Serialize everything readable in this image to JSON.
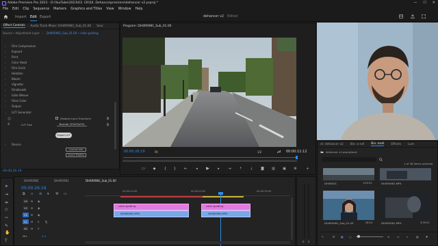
{
  "titlebar": {
    "title": "Adobe Premiere Pro 2023 - D:\\YouTube\\2023\\03. CK\\04. Dehance\\premiere\\dehancer v2.prproj *",
    "min": "—",
    "max": "☐",
    "close": "✕"
  },
  "menu": [
    "File",
    "Edit",
    "Clip",
    "Sequence",
    "Markers",
    "Graphics and Titles",
    "View",
    "Window",
    "Help"
  ],
  "workspace": {
    "tabs": [
      "Import",
      "Edit",
      "Export"
    ],
    "active_tab": "Edit",
    "project_name": "dehancer v2",
    "status": "Edited"
  },
  "effect_controls": {
    "tabs": [
      "Effect Controls",
      "Audio Track Mixer: DH4R0981_Sub_01.00",
      "Sour"
    ],
    "source_label": "Source • Adjustment Layer",
    "clip_label": "DH4R0981_Sub_01.00 • color grading",
    "effects": [
      "Film Compression",
      "Expand",
      "Print",
      "Color Head",
      "Film Grain",
      "Halation",
      "Bloom",
      "Vignette",
      "FilmBreath",
      "Gate Weave",
      "False Color",
      "Output"
    ],
    "lut_group": "LUT Generator",
    "invert_label": "Disable Input Transform",
    "lut_size_label": "LUT Size",
    "lut_size_value": "Normal (33x33x33)",
    "export_button": "Export LUT",
    "device_label": "Device",
    "license_button": "License Info",
    "profiles_button": "Check Profiles"
  },
  "program": {
    "title": "Program: DH4R0981_Sub_01.00",
    "timecode": "00:00:26:19",
    "fit": "Fit",
    "ratio": "1/2",
    "duration": "00:00:11:12"
  },
  "project": {
    "tabs": [
      "ct: dehancer v2",
      "Bin: a-roll",
      "Bin: broll",
      "Effects",
      "Lum"
    ],
    "active_tab": "Bin: broll",
    "path": "dehancer v2.prproj\\broll",
    "count": "1 of 38 items selected",
    "items": [
      {
        "name": "DH4R001",
        "duration": "1:00:31"
      },
      {
        "name": "DH4R0981.MP4",
        "duration": ""
      },
      {
        "name": "DH4R0981_Sub_01.00",
        "duration": "28:24"
      },
      {
        "name": "DH4R0981.MP4",
        "duration": "3:39:21"
      }
    ]
  },
  "timeline": {
    "tabs": [
      "DH4R0982",
      "DH4R0981",
      "DH4R0981_Sub_01.00"
    ],
    "active_tab": "DH4R0981_Sub_01.00",
    "timecode": "00:00:26:19",
    "ruler": [
      "00:00:20:00",
      "00:00:25:00",
      "00:00:30:00"
    ],
    "tracks": [
      "V3",
      "V2",
      "V1",
      "A1",
      "A2"
    ],
    "mix_label": "Mix",
    "mix_value": "0.0",
    "clips": {
      "adj1": "color grading",
      "adj2": "color grading",
      "vid1": "DH4R0981.MP4",
      "vid2": "DH4R0981.MP4"
    }
  },
  "colors": {
    "accent": "#2d8ceb",
    "adjustment_clip": "#e27ae0",
    "video_clip": "#7aa7e6",
    "panel_bg": "#232323"
  }
}
